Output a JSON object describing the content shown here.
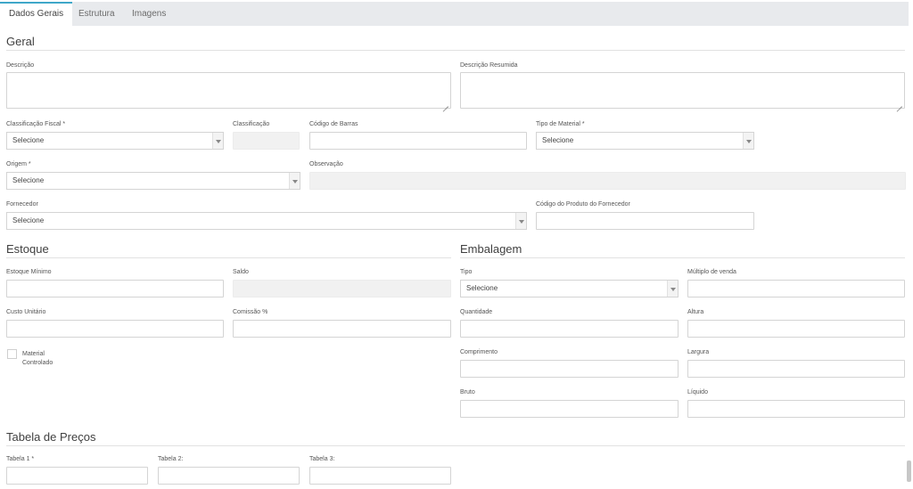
{
  "tabs": [
    {
      "label": "Dados Gerais",
      "active": true
    },
    {
      "label": "Estrutura",
      "active": false
    },
    {
      "label": "Imagens",
      "active": false
    }
  ],
  "sections": {
    "geral": "Geral",
    "estoque": "Estoque",
    "embalagem": "Embalagem",
    "precos": "Tabela de Preços"
  },
  "geral": {
    "descricao": "Descrição",
    "descricao_resumida": "Descrição Resumida",
    "classificacao_fiscal": "Classificação Fiscal *",
    "classificacao_fiscal_value": "Selecione",
    "classificacao": "Classificação",
    "codigo_barras": "Código de Barras",
    "tipo_material": "Tipo de Material *",
    "tipo_material_value": "Selecione",
    "origem": "Origem *",
    "origem_value": "Selecione",
    "observacao": "Observação",
    "fornecedor": "Fornecedor",
    "fornecedor_value": "Selecione",
    "codigo_produto_fornecedor": "Código do Produto do Fornecedor"
  },
  "estoque": {
    "estoque_minimo": "Estoque Mínimo",
    "saldo": "Saldo",
    "custo_unitario": "Custo Unitário",
    "comissao": "Comissão %",
    "material_controlado": "Material\nControlado"
  },
  "embalagem": {
    "tipo": "Tipo",
    "tipo_value": "Selecione",
    "multiplo_venda": "Múltiplo de venda",
    "quantidade": "Quantidade",
    "altura": "Altura",
    "comprimento": "Comprimento",
    "largura": "Largura",
    "bruto": "Bruto",
    "liquido": "Líquido"
  },
  "precos": {
    "tabela1": "Tabela 1 *",
    "tabela2": "Tabela 2:",
    "tabela3": "Tabela 3:"
  }
}
